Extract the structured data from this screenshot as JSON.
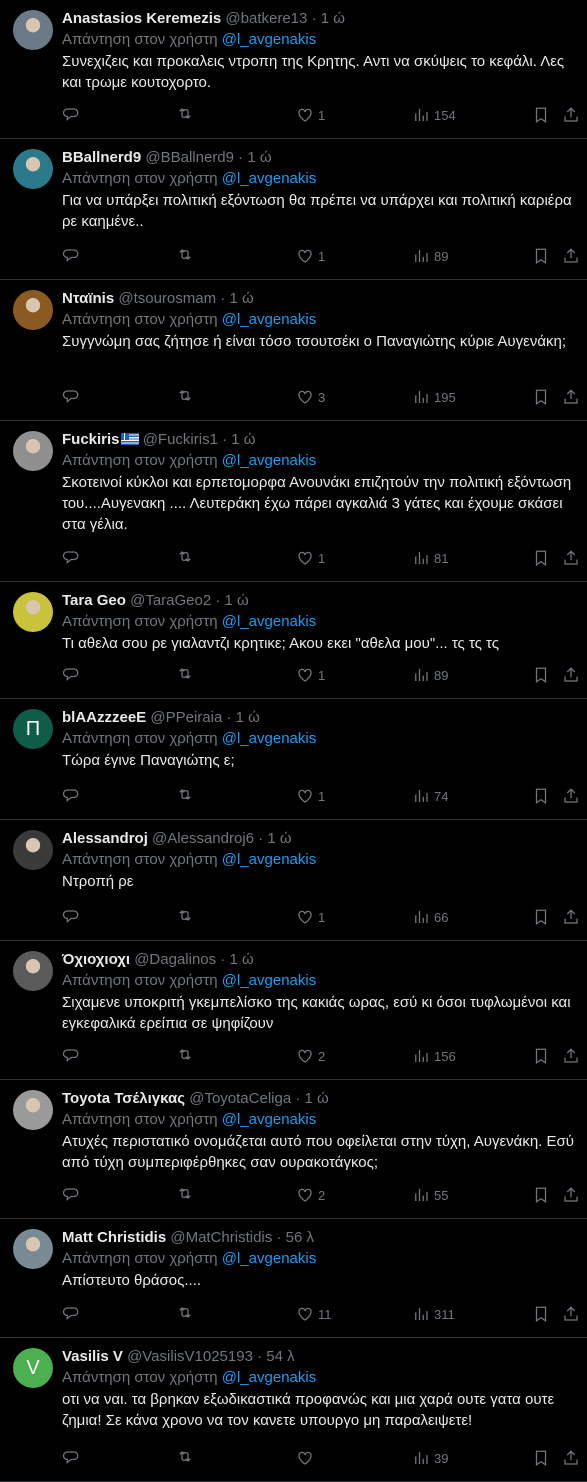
{
  "reply_prefix": "Απάντηση στον χρήστη",
  "mention": "@l_avgenakis",
  "tweets": [
    {
      "name": "Anastasios Keremezis",
      "handle": "@batkere13",
      "time": "1 ώ",
      "text": "Συνεχιζεις και προκαλεις ντροπη της Κρητης. Αντι να σκύψεις το κεφάλι. Λες και τρωμε κουτοχορτο.",
      "replies": "",
      "retweets": "",
      "likes": "1",
      "views": "154",
      "avatar_icon": "profile-photo",
      "avatar_color": "#6b7a86"
    },
    {
      "name": "BBallnerd9",
      "handle": "@BBallnerd9",
      "time": "1 ώ",
      "text": "Για να υπάρξει πολιτική εξόντωση θα πρέπει να υπάρχει και πολιτική καριέρα ρε καημένε..",
      "replies": "",
      "retweets": "",
      "likes": "1",
      "views": "89",
      "avatar_icon": "profile-photo",
      "avatar_color": "#2a7a8c"
    },
    {
      "name": "Νταϊnis",
      "handle": "@tsourosmam",
      "time": "1 ώ",
      "text": "Συγγνώμη σας ζήτησε ή είναι τόσο τσουτσέκι ο Παναγιώτης κύριε Αυγενάκη;",
      "replies": "",
      "retweets": "",
      "likes": "3",
      "views": "195",
      "avatar_icon": "profile-photo",
      "avatar_color": "#8a5a22"
    },
    {
      "name": "Fuckiris",
      "handle": "@Fuckiris1",
      "time": "1 ώ",
      "text": "Σκοτεινοί κύκλοι και ερπετομορφα Ανουνάκι επιζητούν την πολιτική εξόντωση του....Αυγενακη .... Λευτεράκη έχω πάρει αγκαλιά 3 γάτες και έχουμε σκάσει στα γέλια.",
      "replies": "",
      "retweets": "",
      "likes": "1",
      "views": "81",
      "avatar_icon": "profile-photo",
      "avatar_color": "#8f8f8f",
      "flag": true
    },
    {
      "name": "Tara Geo",
      "handle": "@TaraGeo2",
      "time": "1 ώ",
      "text": "Τι αθελα σου ρε γιαλαντζι κρητικε; Ακου εκει \"αθελα μου\"... τς τς τς",
      "replies": "",
      "retweets": "",
      "likes": "1",
      "views": "89",
      "avatar_icon": "profile-photo",
      "avatar_color": "#c9c23a"
    },
    {
      "name": "blAAzzzeeE",
      "handle": "@PPeiraia",
      "time": "1 ώ",
      "text": "Τώρα έγινε Παναγιώτης ε;",
      "replies": "",
      "retweets": "",
      "likes": "1",
      "views": "74",
      "avatar_icon": "letter-avatar",
      "avatar_letter": "Π",
      "avatar_color": "#0f5c4a"
    },
    {
      "name": "Alessandroj",
      "handle": "@Alessandroj6",
      "time": "1 ώ",
      "text": "Ντροπή ρε",
      "replies": "",
      "retweets": "",
      "likes": "1",
      "views": "66",
      "avatar_icon": "profile-photo",
      "avatar_color": "#3a3a3a"
    },
    {
      "name": "Όχιοχιοχι",
      "handle": "@Dagalinos",
      "time": "1 ώ",
      "text": "Σιχαμενε υποκριτή γκεμπελίσκο της κακιάς ωρας, εσύ κι όσοι τυφλωμένοι και εγκεφαλικά ερείπια σε ψηφίζουν",
      "replies": "",
      "retweets": "",
      "likes": "2",
      "views": "156",
      "avatar_icon": "profile-photo",
      "avatar_color": "#5a5a5a"
    },
    {
      "name": "Toyota Τσέλιγκας",
      "handle": "@ToyotaCeliga",
      "time": "1 ώ",
      "text": "Ατυχές περιστατικό ονομάζεται αυτό που οφείλεται στην τύχη, Αυγενάκη. Εσύ από τύχη συμπεριφέρθηκες σαν ουρακοτάγκος;",
      "replies": "",
      "retweets": "",
      "likes": "2",
      "views": "55",
      "avatar_icon": "profile-photo",
      "avatar_color": "#9a9a9a"
    },
    {
      "name": "Matt Christidis",
      "handle": "@MatChristidis",
      "time": "56 λ",
      "text": "Απίστευτο θράσος....",
      "replies": "",
      "retweets": "",
      "likes": "11",
      "views": "311",
      "avatar_icon": "profile-photo",
      "avatar_color": "#7a8a94"
    },
    {
      "name": "Vasilis V",
      "handle": "@VasilisV1025193",
      "time": "54 λ",
      "text": "οτι να ναι. τα βρηκαν εξωδικαστικά προφανώς και μια χαρά ουτε γατα ουτε ζημια! Σε κάνα χρονο να τον κανετε υπουργο μη παραλειψετε!",
      "replies": "",
      "retweets": "",
      "likes": "",
      "views": "39",
      "avatar_icon": "letter-avatar",
      "avatar_letter": "V",
      "avatar_color": "#4caf50"
    }
  ]
}
